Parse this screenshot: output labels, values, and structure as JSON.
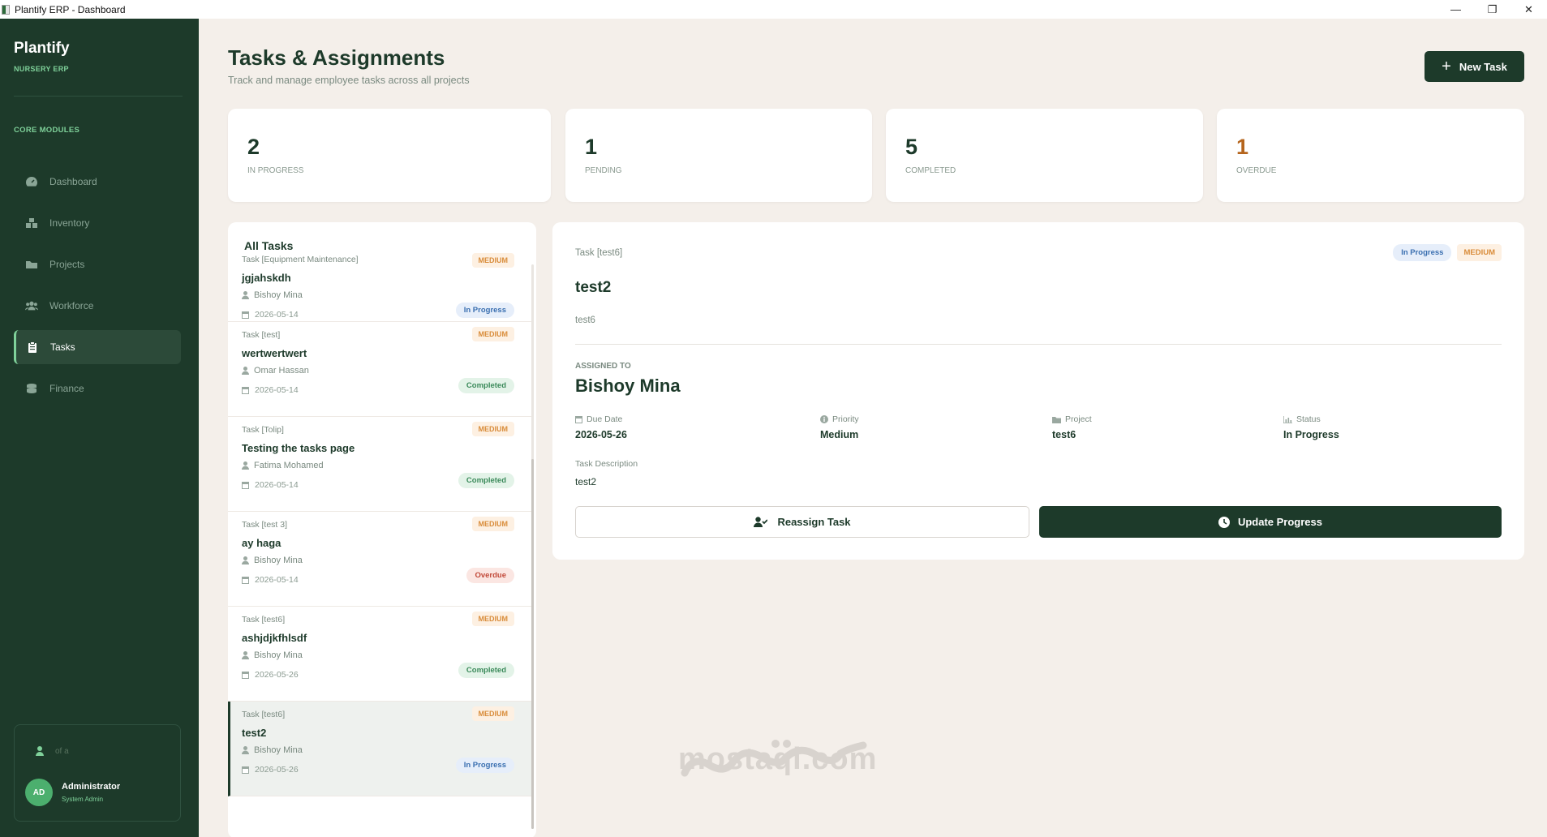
{
  "window": {
    "title": "Plantify ERP - Dashboard"
  },
  "sidebar": {
    "brand": "Plantify",
    "brand_sub": "NURSERY ERP",
    "section": "CORE MODULES",
    "items": [
      {
        "label": "Dashboard",
        "icon": "gauge-icon"
      },
      {
        "label": "Inventory",
        "icon": "boxes-icon"
      },
      {
        "label": "Projects",
        "icon": "folder-icon"
      },
      {
        "label": "Workforce",
        "icon": "users-icon"
      },
      {
        "label": "Tasks",
        "icon": "clipboard-icon",
        "active": true
      },
      {
        "label": "Finance",
        "icon": "coins-icon"
      }
    ],
    "user": {
      "dim_label": "of a",
      "initials": "AD",
      "name": "Administrator",
      "role": "System Admin"
    }
  },
  "header": {
    "title": "Tasks & Assignments",
    "subtitle": "Track and manage employee tasks across all projects",
    "new_task": "New Task"
  },
  "stats": [
    {
      "value": "2",
      "label": "IN PROGRESS"
    },
    {
      "value": "1",
      "label": "PENDING"
    },
    {
      "value": "5",
      "label": "COMPLETED"
    },
    {
      "value": "1",
      "label": "OVERDUE"
    }
  ],
  "task_list": {
    "title": "All Tasks",
    "items": [
      {
        "project": "Task [Equipment Maintenance]",
        "name": "jgjahskdh",
        "person": "Bishoy Mina",
        "date": "2026-05-14",
        "priority": "MEDIUM",
        "status": "In Progress"
      },
      {
        "project": "Task [test]",
        "name": "wertwertwert",
        "person": "Omar Hassan",
        "date": "2026-05-14",
        "priority": "MEDIUM",
        "status": "Completed"
      },
      {
        "project": "Task [Tolip]",
        "name": "Testing the tasks page",
        "person": "Fatima Mohamed",
        "date": "2026-05-14",
        "priority": "MEDIUM",
        "status": "Completed"
      },
      {
        "project": "Task [test 3]",
        "name": "ay haga",
        "person": "Bishoy Mina",
        "date": "2026-05-14",
        "priority": "MEDIUM",
        "status": "Overdue"
      },
      {
        "project": "Task [test6]",
        "name": "ashjdjkfhlsdf",
        "person": "Bishoy Mina",
        "date": "2026-05-26",
        "priority": "MEDIUM",
        "status": "Completed"
      },
      {
        "project": "Task [test6]",
        "name": "test2",
        "person": "Bishoy Mina",
        "date": "2026-05-26",
        "priority": "MEDIUM",
        "status": "In Progress"
      }
    ]
  },
  "detail": {
    "project_tag": "Task [test6]",
    "status_badge": "In Progress",
    "priority_badge": "MEDIUM",
    "title": "test2",
    "short_desc": "test6",
    "assigned_label": "ASSIGNED TO",
    "assigned_to": "Bishoy Mina",
    "meta": [
      {
        "key": "Due Date",
        "value": "2026-05-26",
        "icon": "calendar-icon"
      },
      {
        "key": "Priority",
        "value": "Medium",
        "icon": "info-icon"
      },
      {
        "key": "Project",
        "value": "test6",
        "icon": "folder-icon"
      },
      {
        "key": "Status",
        "value": "In Progress",
        "icon": "chart-icon"
      }
    ],
    "desc_label": "Task Description",
    "desc": "test2",
    "reassign": "Reassign Task",
    "update": "Update Progress"
  },
  "watermark": {
    "text": "mostaql.com"
  }
}
